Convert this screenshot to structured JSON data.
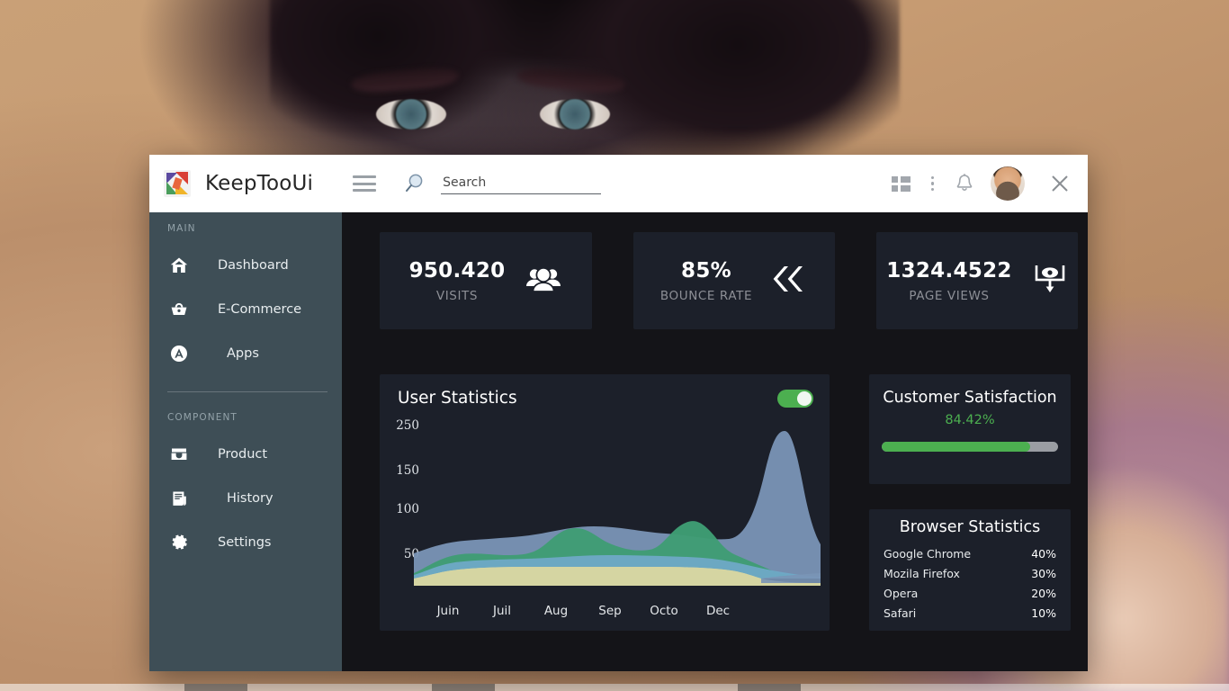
{
  "window": {
    "brand": "KeepTooUi",
    "close_label": "×"
  },
  "header": {
    "search_placeholder": "Search",
    "search_value": "",
    "icons": {
      "menu": "hamburger-icon",
      "search": "search-icon",
      "grid": "grid-icon",
      "dots": "more-vertical-icon",
      "bell": "bell-icon",
      "avatar": "avatar",
      "close": "close-icon"
    }
  },
  "sidebar": {
    "section_main": "MAIN",
    "section_component": "COMPONENT",
    "main_items": [
      {
        "label": "Dashboard",
        "icon": "home-icon"
      },
      {
        "label": "E-Commerce",
        "icon": "basket-icon"
      },
      {
        "label": "Apps",
        "icon": "apps-icon"
      }
    ],
    "component_items": [
      {
        "label": "Product",
        "icon": "inbox-icon"
      },
      {
        "label": "History",
        "icon": "history-icon"
      },
      {
        "label": "Settings",
        "icon": "gear-icon"
      }
    ]
  },
  "kpis": [
    {
      "value": "950.420",
      "label": "VISITS",
      "icon": "users-icon"
    },
    {
      "value": "85%",
      "label": "BOUNCE RATE",
      "icon": "double-chevron-left-icon"
    },
    {
      "value": "1324.4522",
      "label": "PAGE VIEWS",
      "icon": "page-views-icon"
    }
  ],
  "user_statistics": {
    "title": "User Statistics",
    "toggle_on": true
  },
  "customer_satisfaction": {
    "title": "Customer Satisfaction",
    "percent_label": "84.42%",
    "percent_value": 84.42,
    "bar_color": "#4caf50"
  },
  "browser_statistics": {
    "title": "Browser Statistics",
    "rows": [
      {
        "name": "Google Chrome",
        "value": "40%"
      },
      {
        "name": "Mozila Firefox",
        "value": "30%"
      },
      {
        "name": "Opera",
        "value": "20%"
      },
      {
        "name": "Safari",
        "value": "10%"
      }
    ]
  },
  "chart_data": {
    "type": "area",
    "title": "User Statistics",
    "xlabel": "",
    "ylabel": "",
    "categories": [
      "Juin",
      "Juil",
      "Aug",
      "Sep",
      "Octo",
      "Dec"
    ],
    "yticks": [
      250,
      150,
      100,
      50
    ],
    "ylim": [
      0,
      280
    ],
    "grid": false,
    "legend": "none",
    "stacked_overlay": true,
    "series": [
      {
        "name": "series-khaki",
        "color": "#d5d5a2",
        "values": [
          30,
          48,
          50,
          50,
          50,
          48,
          50,
          50,
          48,
          20,
          10,
          12
        ]
      },
      {
        "name": "series-lightblue",
        "color": "#6fa9c6",
        "values": [
          45,
          62,
          62,
          62,
          66,
          66,
          66,
          64,
          60,
          30,
          16,
          18
        ]
      },
      {
        "name": "series-green",
        "color": "#3f9d74",
        "values": [
          40,
          72,
          66,
          60,
          82,
          68,
          66,
          90,
          70,
          34,
          14,
          14
        ]
      },
      {
        "name": "series-blue",
        "color": "#7a95b6",
        "values": [
          50,
          60,
          60,
          62,
          66,
          78,
          78,
          70,
          68,
          120,
          250,
          95
        ]
      }
    ]
  }
}
